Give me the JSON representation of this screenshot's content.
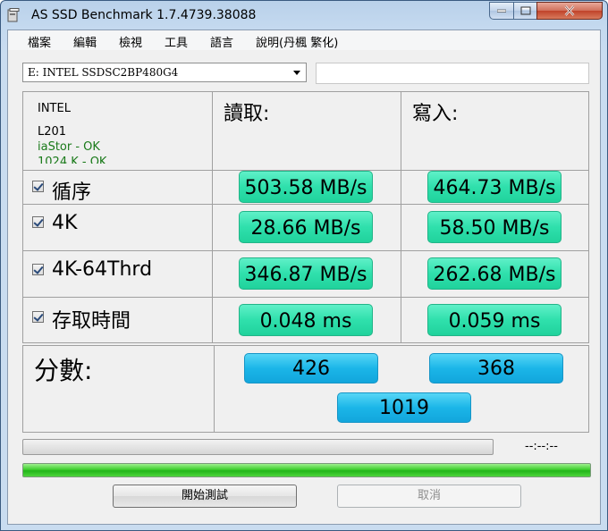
{
  "window": {
    "title": "AS SSD Benchmark 1.7.4739.38088",
    "accent": "#b9d1ea"
  },
  "menu": [
    "檔案",
    "編輯",
    "檢視",
    "工具",
    "語言",
    "說明(丹楓 繁化)"
  ],
  "drive": {
    "selected": "E: INTEL SSDSC2BP480G4"
  },
  "info": {
    "brand": "INTEL",
    "model": "L201",
    "driver": "iaStor - OK",
    "alignment": "1024 K - OK"
  },
  "columns": {
    "read": "讀取:",
    "write": "寫入:"
  },
  "rows": [
    {
      "label": "循序",
      "checked": true,
      "read": "503.58 MB/s",
      "write": "464.73 MB/s"
    },
    {
      "label": "4K",
      "checked": true,
      "read": "28.66 MB/s",
      "write": "58.50 MB/s"
    },
    {
      "label": "4K-64Thrd",
      "checked": true,
      "read": "346.87 MB/s",
      "write": "262.68 MB/s"
    },
    {
      "label": "存取時間",
      "checked": true,
      "read": "0.048 ms",
      "write": "0.059 ms"
    }
  ],
  "score": {
    "label": "分數:",
    "read": "426",
    "write": "368",
    "total": "1019"
  },
  "status": {
    "elapsed": "--:--:--",
    "progress": 0,
    "overall_progress": 1.0
  },
  "buttons": {
    "start": "開始測試",
    "cancel": "取消"
  },
  "colors": {
    "result_green": "#2fe0ac",
    "score_blue": "#1bb6e8",
    "progress_green": "#3ece2e",
    "ok_text": "#1a7a1a"
  }
}
